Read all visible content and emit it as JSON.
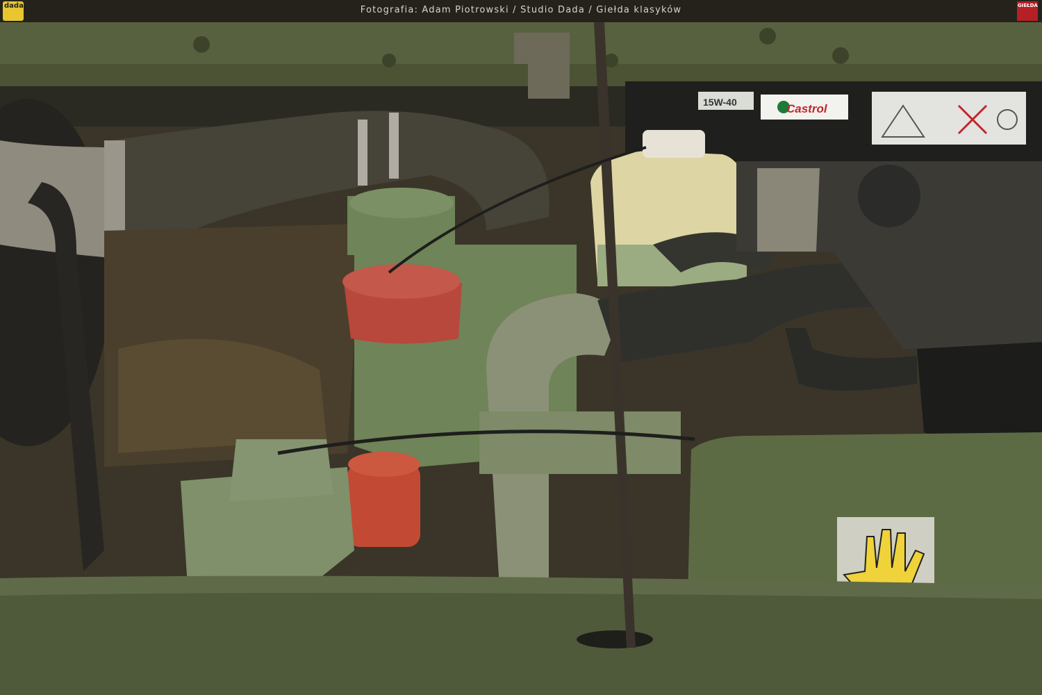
{
  "header": {
    "caption": "Fotografia: Adam Piotrowski / Studio Dada / Giełda klasyków",
    "logo_left_text": "dada",
    "logo_right_text": "GIEŁDA"
  },
  "labels": {
    "oil_grade": "15W-40",
    "oil_brand": "Castrol"
  },
  "colors": {
    "body_green": "#4f5a3a",
    "hose_black": "#2f302b",
    "cap_red": "#b8473c",
    "engine_green": "#6f8458",
    "castrol_red": "#c0272d"
  }
}
